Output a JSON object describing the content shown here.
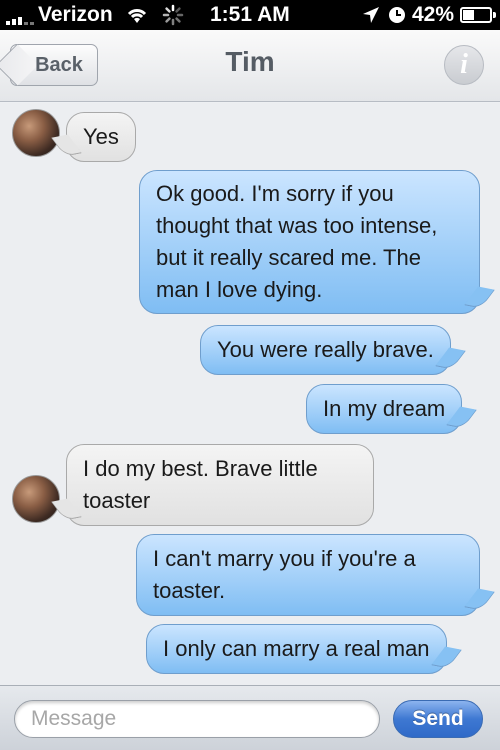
{
  "status_bar": {
    "carrier": "Verizon",
    "time": "1:51 AM",
    "battery": "42%",
    "battery_level": 0.42,
    "icons": [
      "signal-icon",
      "wifi-icon",
      "activity-spinner-icon",
      "location-arrow-icon",
      "alarm-icon",
      "battery-icon"
    ]
  },
  "nav": {
    "back_label": "Back",
    "title": "Tim",
    "info_label": "i"
  },
  "messages": [
    {
      "from": "them",
      "text": "Yes"
    },
    {
      "from": "me",
      "text": "Ok good. I'm sorry if you thought that was too intense, but it really scared me. The man I love dying."
    },
    {
      "from": "me",
      "text": "You were really brave."
    },
    {
      "from": "me",
      "text": "In my dream"
    },
    {
      "from": "them",
      "text": "I do my best. Brave little toaster"
    },
    {
      "from": "me",
      "text": "I can't marry you if you're a toaster."
    },
    {
      "from": "me",
      "text": "I only can marry a real man"
    }
  ],
  "composer": {
    "placeholder": "Message",
    "value": "",
    "send_label": "Send"
  },
  "colors": {
    "sent_bubble": "#7fbdf3",
    "received_bubble": "#e1e1e1",
    "send_button": "#3e78d2"
  }
}
